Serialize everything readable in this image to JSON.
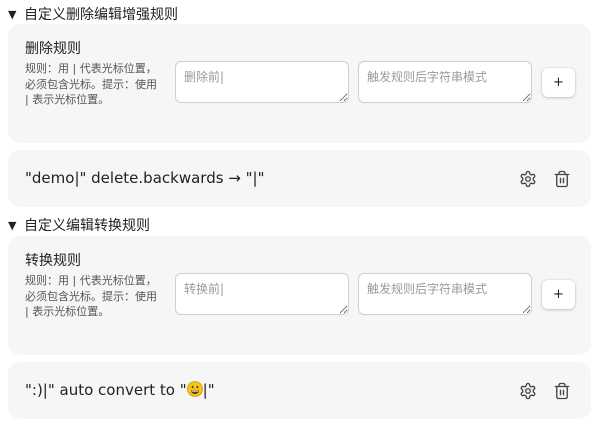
{
  "sections": [
    {
      "toggle_arrow": "▼",
      "title": "自定义删除编辑增强规则",
      "rule_title": "删除规则",
      "rule_desc": "规则：用 | 代表光标位置，必须包含光标。提示：使用 | 表示光标位置。",
      "before_placeholder": "删除前|",
      "trigger_placeholder": "触发规则后字符串模式",
      "add_label": "+",
      "example": {
        "text": "\"demo|\" delete.backwards → \"|\"",
        "settings_icon": "gear-icon",
        "delete_icon": "trash-icon"
      }
    },
    {
      "toggle_arrow": "▼",
      "title": "自定义编辑转换规则",
      "rule_title": "转换规则",
      "rule_desc": "规则：用 | 代表光标位置，必须包含光标。提示：使用 | 表示光标位置。",
      "before_placeholder": "转换前|",
      "trigger_placeholder": "触发规则后字符串模式",
      "add_label": "+",
      "example": {
        "text_before_emoji": "\":)|\" auto convert to \"",
        "emoji": "grinning-face-emoji",
        "text_after_emoji": "|\"",
        "settings_icon": "gear-icon",
        "delete_icon": "trash-icon"
      }
    }
  ]
}
